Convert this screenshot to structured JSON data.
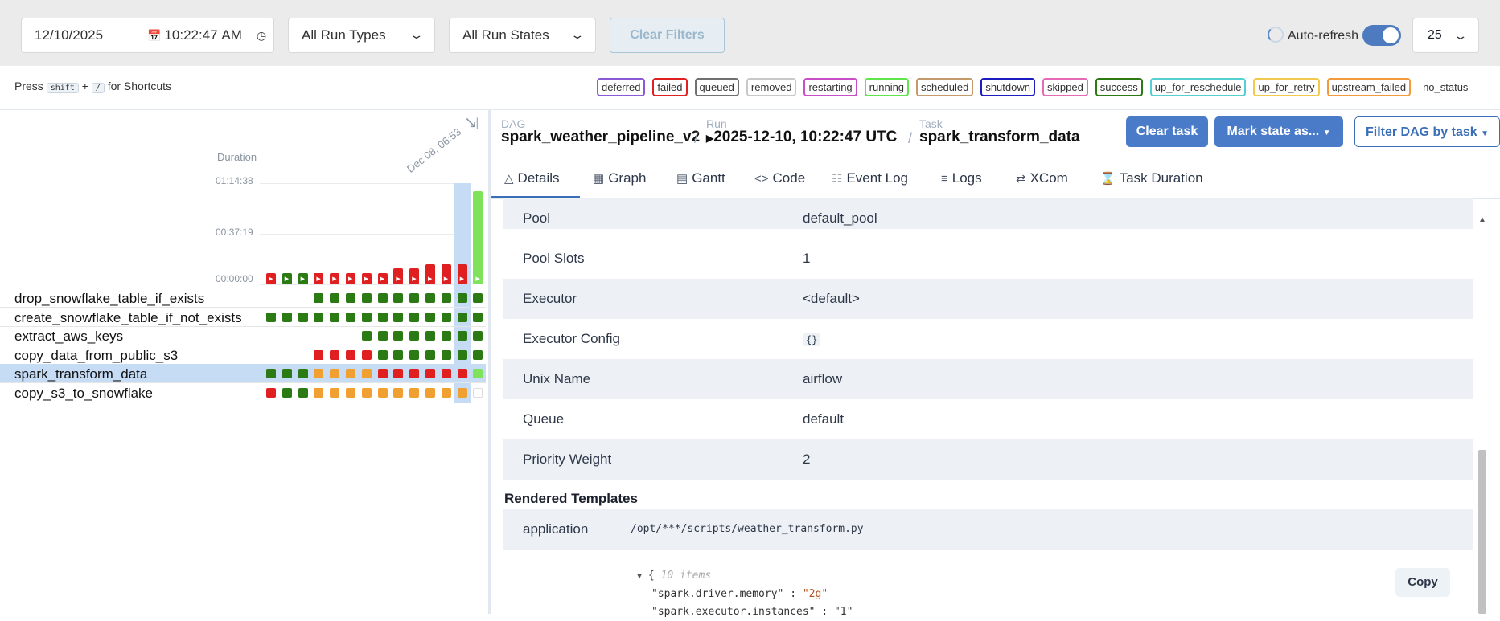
{
  "filters": {
    "date": "12/10/2025",
    "time": "10:22:47",
    "ampm": "AM",
    "run_types": "All Run Types",
    "run_states": "All Run States",
    "clear_filters": "Clear Filters",
    "auto_refresh": "Auto-refresh",
    "auto_refresh_on": true,
    "num_runs": "25"
  },
  "shortcuts": {
    "press": "Press",
    "key1": "shift",
    "plus": "+",
    "key2": "/",
    "suffix": "for Shortcuts"
  },
  "legend": [
    {
      "label": "deferred",
      "color": "#8a5ad6"
    },
    {
      "label": "failed",
      "color": "#e02020"
    },
    {
      "label": "queued",
      "color": "#707070"
    },
    {
      "label": "removed",
      "color": "#c8c8c8"
    },
    {
      "label": "restarting",
      "color": "#c84fc8"
    },
    {
      "label": "running",
      "color": "#5ee64a"
    },
    {
      "label": "scheduled",
      "color": "#c59a6b"
    },
    {
      "label": "shutdown",
      "color": "#1c1cbf"
    },
    {
      "label": "skipped",
      "color": "#e66ab5"
    },
    {
      "label": "success",
      "color": "#2c7a14"
    },
    {
      "label": "up_for_reschedule",
      "color": "#55d0d0"
    },
    {
      "label": "up_for_retry",
      "color": "#f2c94c"
    },
    {
      "label": "upstream_failed",
      "color": "#f29a3c"
    },
    {
      "label": "no_status",
      "color": ""
    }
  ],
  "grid": {
    "duration_label": "Duration",
    "date_label": "Dec 08, 06:53",
    "ticks": [
      "01:14:38",
      "00:37:19",
      "00:00:00"
    ],
    "runs": [
      {
        "state": "failed",
        "duration_frac": 0.06
      },
      {
        "state": "success",
        "duration_frac": 0.06
      },
      {
        "state": "success",
        "duration_frac": 0.06
      },
      {
        "state": "failed",
        "duration_frac": 0.06
      },
      {
        "state": "failed",
        "duration_frac": 0.06
      },
      {
        "state": "failed",
        "duration_frac": 0.06
      },
      {
        "state": "failed",
        "duration_frac": 0.06
      },
      {
        "state": "failed",
        "duration_frac": 0.06
      },
      {
        "state": "failed",
        "duration_frac": 0.16
      },
      {
        "state": "failed",
        "duration_frac": 0.16
      },
      {
        "state": "failed",
        "duration_frac": 0.2
      },
      {
        "state": "failed",
        "duration_frac": 0.2
      },
      {
        "state": "failed",
        "duration_frac": 0.2
      },
      {
        "state": "running",
        "duration_frac": 0.93
      }
    ],
    "tasks": [
      {
        "name": "drop_snowflake_table_if_exists",
        "states": [
          "",
          "",
          "",
          "success",
          "success",
          "success",
          "success",
          "success",
          "success",
          "success",
          "success",
          "success",
          "success",
          "success"
        ]
      },
      {
        "name": "create_snowflake_table_if_not_exists",
        "states": [
          "success",
          "success",
          "success",
          "success",
          "success",
          "success",
          "success",
          "success",
          "success",
          "success",
          "success",
          "success",
          "success",
          "success"
        ]
      },
      {
        "name": "extract_aws_keys",
        "states": [
          "",
          "",
          "",
          "",
          "",
          "",
          "success",
          "success",
          "success",
          "success",
          "success",
          "success",
          "success",
          "success"
        ]
      },
      {
        "name": "copy_data_from_public_s3",
        "states": [
          "",
          "",
          "",
          "failed",
          "failed",
          "failed",
          "failed",
          "success",
          "success",
          "success",
          "success",
          "success",
          "success",
          "success"
        ]
      },
      {
        "name": "spark_transform_data",
        "states": [
          "success",
          "success",
          "success",
          "upstream_failed",
          "upstream_failed",
          "upstream_failed",
          "upstream_failed",
          "failed",
          "failed",
          "failed",
          "failed",
          "failed",
          "failed",
          "running"
        ]
      },
      {
        "name": "copy_s3_to_snowflake",
        "states": [
          "failed",
          "success",
          "success",
          "upstream_failed",
          "upstream_failed",
          "upstream_failed",
          "upstream_failed",
          "upstream_failed",
          "upstream_failed",
          "upstream_failed",
          "upstream_failed",
          "upstream_failed",
          "upstream_failed",
          "none"
        ]
      }
    ],
    "selected_task": "spark_transform_data"
  },
  "breadcrumb": {
    "dag_label": "DAG",
    "dag_value": "spark_weather_pipeline_v2",
    "run_label": "Run",
    "run_value": "2025-12-10, 10:22:47 UTC",
    "task_label": "Task",
    "task_value": "spark_transform_data"
  },
  "actions": {
    "clear_task": "Clear task",
    "mark_state": "Mark state as...",
    "filter_dag": "Filter DAG by task"
  },
  "tabs": [
    "Details",
    "Graph",
    "Gantt",
    "Code",
    "Event Log",
    "Logs",
    "XCom",
    "Task Duration"
  ],
  "active_tab": "Details",
  "details": [
    {
      "key": "Pool",
      "value": "default_pool"
    },
    {
      "key": "Pool Slots",
      "value": "1"
    },
    {
      "key": "Executor",
      "value": "<default>"
    },
    {
      "key": "Executor Config",
      "value": "{}"
    },
    {
      "key": "Unix Name",
      "value": "airflow"
    },
    {
      "key": "Queue",
      "value": "default"
    },
    {
      "key": "Priority Weight",
      "value": "2"
    }
  ],
  "rendered": {
    "title": "Rendered Templates",
    "app_key": "application",
    "app_value": "/opt/***/scripts/weather_transform.py",
    "json_open": "{",
    "json_count": "10 items",
    "json_line1_key": "\"spark.driver.memory\"",
    "json_line1_val": "\"2g\"",
    "json_line2": "\"spark.executor.instances\" : \"1\"",
    "copy": "Copy"
  },
  "state_colors": {
    "success": "#2c7a14",
    "failed": "#e02020",
    "upstream_failed": "#f0a030",
    "running": "#7ee35a"
  }
}
